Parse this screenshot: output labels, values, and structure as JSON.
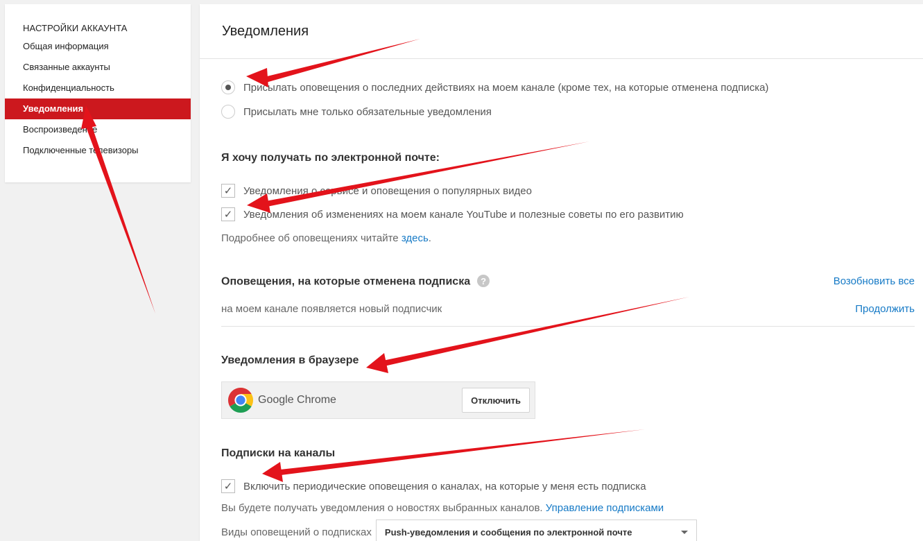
{
  "sidebar": {
    "title": "НАСТРОЙКИ АККАУНТА",
    "items": [
      {
        "label": "Общая информация"
      },
      {
        "label": "Связанные аккаунты"
      },
      {
        "label": "Конфиденциальность"
      },
      {
        "label": "Уведомления"
      },
      {
        "label": "Воспроизведение"
      },
      {
        "label": "Подключенные телевизоры"
      }
    ],
    "active_index": 3
  },
  "main": {
    "title": "Уведомления",
    "radios": [
      {
        "label": "Присылать оповещения о последних действиях на моем канале (кроме тех, на которые отменена подписка)",
        "selected": true
      },
      {
        "label": "Присылать мне только обязательные уведомления",
        "selected": false
      }
    ],
    "email": {
      "title": "Я хочу получать по электронной почте:",
      "checks": [
        {
          "label": "Уведомления о сервисе и оповещения о популярных видео",
          "checked": true
        },
        {
          "label": "Уведомления об изменениях на моем канале YouTube и полезные советы по его развитию",
          "checked": true
        }
      ],
      "more_text": "Подробнее об оповещениях читайте ",
      "more_link": "здесь",
      "more_suffix": "."
    },
    "unsubscribed": {
      "title": "Оповещения, на которые отменена подписка",
      "help_icon": "?",
      "resume_all": "Возобновить все",
      "item_text": "на моем канале появляется новый подписчик",
      "item_action": "Продолжить"
    },
    "browser": {
      "title": "Уведомления в браузере",
      "browser_name": "Google Chrome",
      "disable_button": "Отключить"
    },
    "subscriptions": {
      "title": "Подписки на каналы",
      "check_label": "Включить периодические оповещения о каналах, на которые у меня есть подписка",
      "checked": true,
      "info_text": "Вы будете получать уведомления о новостях выбранных каналов. ",
      "manage_link": "Управление подписками",
      "type_label": "Виды оповещений о подписках",
      "type_value": "Push-уведомления и сообщения по электронной почте"
    }
  },
  "colors": {
    "accent": "#cc181e",
    "link": "#167ac6",
    "arrow": "#e3131b"
  },
  "icons": {
    "check": "✓",
    "help": "question-circle-icon",
    "dropdown": "caret-down-icon",
    "browser": "chrome-logo-icon"
  }
}
